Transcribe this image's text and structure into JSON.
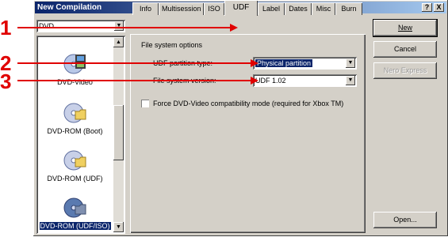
{
  "window": {
    "title": "New Compilation",
    "help_label": "?",
    "close_label": "X"
  },
  "media_combo": {
    "value": "DVD"
  },
  "compilation_types": [
    {
      "label": "DVD-Video",
      "icon": "dvd-video-icon",
      "selected": false
    },
    {
      "label": "DVD-ROM (Boot)",
      "icon": "dvd-rom-boot-icon",
      "selected": false
    },
    {
      "label": "DVD-ROM (UDF)",
      "icon": "dvd-rom-udf-icon",
      "selected": false
    },
    {
      "label": "DVD-ROM (UDF/ISO)",
      "icon": "dvd-rom-udf-iso-icon",
      "selected": true
    }
  ],
  "tabs": [
    "Info",
    "Multisession",
    "ISO",
    "UDF",
    "Label",
    "Dates",
    "Misc",
    "Burn"
  ],
  "active_tab": "UDF",
  "udf_panel": {
    "section_title": "File system options",
    "partition_label": "UDF partition type:",
    "partition_value": "Physical partition",
    "version_label": "File system version:",
    "version_value": "UDF 1.02",
    "checkbox_label": "Force DVD-Video compatibility mode (required for Xbox TM)",
    "checkbox_checked": false
  },
  "buttons": {
    "new": "New",
    "cancel": "Cancel",
    "nero_express": "Nero Express",
    "open": "Open..."
  },
  "callouts": [
    "1",
    "2",
    "3"
  ],
  "colors": {
    "callout": "#e00000",
    "titlebar": "#0a246a",
    "selection": "#0a246a"
  }
}
